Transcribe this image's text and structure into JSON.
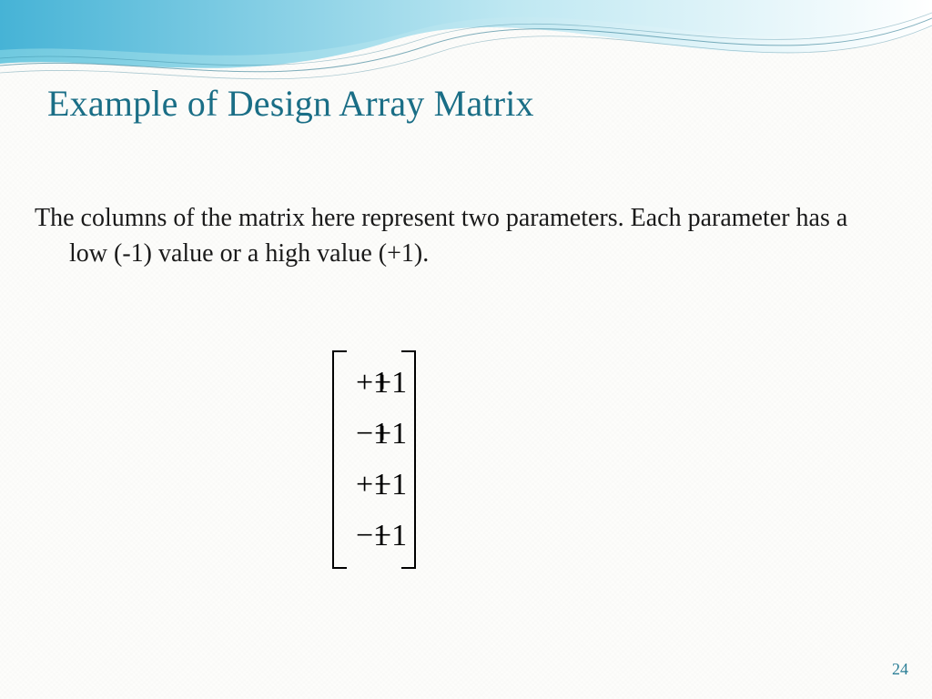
{
  "title": "Example of Design Array Matrix",
  "body": "The columns of the matrix here represent two parameters. Each parameter has a low (-1) value or a high value (+1).",
  "matrix": {
    "rows": [
      [
        "+1",
        "+1"
      ],
      [
        "−1",
        "+1"
      ],
      [
        "+1",
        "−1"
      ],
      [
        "−1",
        "−1"
      ]
    ]
  },
  "page_number": "24"
}
